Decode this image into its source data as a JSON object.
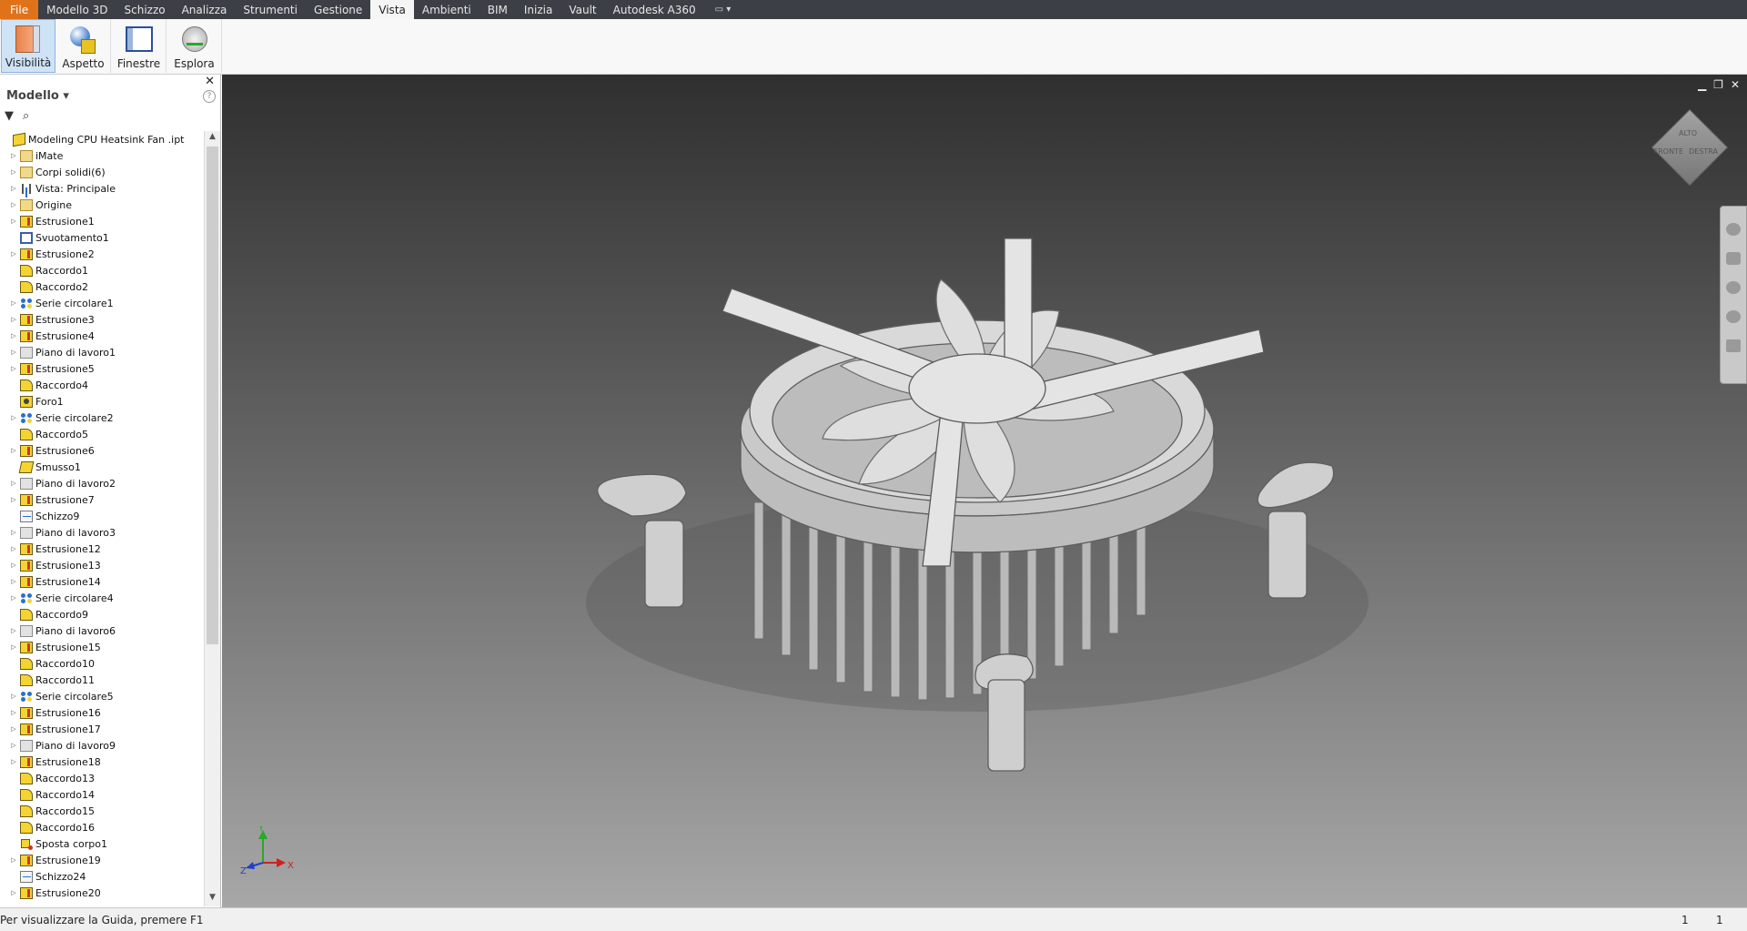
{
  "menu": {
    "file": "File",
    "items": [
      "Modello 3D",
      "Schizzo",
      "Analizza",
      "Strumenti",
      "Gestione",
      "Vista",
      "Ambienti",
      "BIM",
      "Inizia",
      "Vault",
      "Autodesk A360"
    ],
    "active": "Vista"
  },
  "ribbon": {
    "buttons": [
      {
        "label": "Visibilità",
        "icon": "visibility-icon",
        "active": true
      },
      {
        "label": "Aspetto",
        "icon": "appearance-icon",
        "active": false
      },
      {
        "label": "Finestre",
        "icon": "windows-icon",
        "active": false
      },
      {
        "label": "Esplora",
        "icon": "navigate-icon",
        "active": false
      }
    ]
  },
  "browser": {
    "title": "Modello",
    "close": "✕",
    "help": "?",
    "root": "Modeling CPU Heatsink Fan .ipt",
    "items": [
      {
        "label": "iMate",
        "icon": "fold",
        "expand": true
      },
      {
        "label": "Corpi solidi(6)",
        "icon": "fold",
        "expand": true
      },
      {
        "label": "Vista: Principale",
        "icon": "view",
        "expand": true
      },
      {
        "label": "Origine",
        "icon": "fold",
        "expand": true
      },
      {
        "label": "Estrusione1",
        "icon": "ext",
        "expand": true
      },
      {
        "label": "Svuotamento1",
        "icon": "shell",
        "expand": false
      },
      {
        "label": "Estrusione2",
        "icon": "ext",
        "expand": true
      },
      {
        "label": "Raccordo1",
        "icon": "fil",
        "expand": false
      },
      {
        "label": "Raccordo2",
        "icon": "fil",
        "expand": false
      },
      {
        "label": "Serie circolare1",
        "icon": "pat",
        "expand": true
      },
      {
        "label": "Estrusione3",
        "icon": "ext",
        "expand": true
      },
      {
        "label": "Estrusione4",
        "icon": "ext",
        "expand": true
      },
      {
        "label": "Piano di lavoro1",
        "icon": "plane",
        "expand": true
      },
      {
        "label": "Estrusione5",
        "icon": "ext",
        "expand": true
      },
      {
        "label": "Raccordo4",
        "icon": "fil",
        "expand": false
      },
      {
        "label": "Foro1",
        "icon": "hole",
        "expand": false
      },
      {
        "label": "Serie circolare2",
        "icon": "pat",
        "expand": true
      },
      {
        "label": "Raccordo5",
        "icon": "fil",
        "expand": false
      },
      {
        "label": "Estrusione6",
        "icon": "ext",
        "expand": true
      },
      {
        "label": "Smusso1",
        "icon": "cham",
        "expand": false
      },
      {
        "label": "Piano di lavoro2",
        "icon": "plane",
        "expand": true
      },
      {
        "label": "Estrusione7",
        "icon": "ext",
        "expand": true
      },
      {
        "label": "Schizzo9",
        "icon": "sk",
        "expand": false
      },
      {
        "label": "Piano di lavoro3",
        "icon": "plane",
        "expand": true
      },
      {
        "label": "Estrusione12",
        "icon": "ext",
        "expand": true
      },
      {
        "label": "Estrusione13",
        "icon": "ext",
        "expand": true
      },
      {
        "label": "Estrusione14",
        "icon": "ext",
        "expand": true
      },
      {
        "label": "Serie circolare4",
        "icon": "pat",
        "expand": true
      },
      {
        "label": "Raccordo9",
        "icon": "fil",
        "expand": false
      },
      {
        "label": "Piano di lavoro6",
        "icon": "plane",
        "expand": true
      },
      {
        "label": "Estrusione15",
        "icon": "ext",
        "expand": true
      },
      {
        "label": "Raccordo10",
        "icon": "fil",
        "expand": false
      },
      {
        "label": "Raccordo11",
        "icon": "fil",
        "expand": false
      },
      {
        "label": "Serie circolare5",
        "icon": "pat",
        "expand": true
      },
      {
        "label": "Estrusione16",
        "icon": "ext",
        "expand": true
      },
      {
        "label": "Estrusione17",
        "icon": "ext",
        "expand": true
      },
      {
        "label": "Piano di lavoro9",
        "icon": "plane",
        "expand": true
      },
      {
        "label": "Estrusione18",
        "icon": "ext",
        "expand": true
      },
      {
        "label": "Raccordo13",
        "icon": "fil",
        "expand": false
      },
      {
        "label": "Raccordo14",
        "icon": "fil",
        "expand": false
      },
      {
        "label": "Raccordo15",
        "icon": "fil",
        "expand": false
      },
      {
        "label": "Raccordo16",
        "icon": "fil",
        "expand": false
      },
      {
        "label": "Sposta corpo1",
        "icon": "move",
        "expand": false
      },
      {
        "label": "Estrusione19",
        "icon": "ext",
        "expand": true
      },
      {
        "label": "Schizzo24",
        "icon": "sk",
        "expand": false
      },
      {
        "label": "Estrusione20",
        "icon": "ext",
        "expand": true
      }
    ]
  },
  "viewcube": {
    "top": "ALTO",
    "front": "FRONTE",
    "right": "DESTRA"
  },
  "triad": {
    "x": "X",
    "y": "Y",
    "z": "Z"
  },
  "colors": {
    "accent": "#e0731a",
    "menubar": "#3c3f45",
    "ribbon_active": "#cfe3f7"
  },
  "status": {
    "message": "Per visualizzare la Guida, premere F1",
    "count1": "1",
    "count2": "1"
  }
}
